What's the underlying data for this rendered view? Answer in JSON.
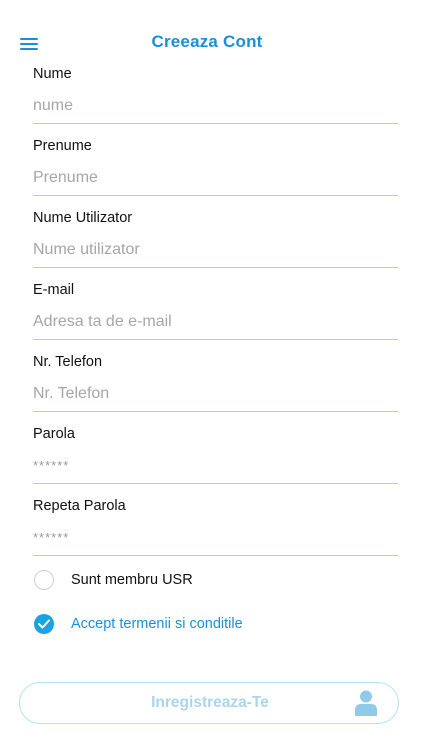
{
  "header": {
    "title": "Creeaza Cont",
    "menu_icon": "hamburger-menu-icon"
  },
  "form": {
    "fields": [
      {
        "label": "Nume",
        "placeholder": "nume",
        "value": ""
      },
      {
        "label": "Prenume",
        "placeholder": "Prenume",
        "value": ""
      },
      {
        "label": "Nume Utilizator",
        "placeholder": "Nume utilizator",
        "value": ""
      },
      {
        "label": "E-mail",
        "placeholder": "Adresa ta de e-mail",
        "value": ""
      },
      {
        "label": "Nr. Telefon",
        "placeholder": "Nr. Telefon",
        "value": ""
      },
      {
        "label": "Parola",
        "placeholder": "******",
        "value": ""
      },
      {
        "label": "Repeta Parola",
        "placeholder": "******",
        "value": ""
      }
    ]
  },
  "options": {
    "usr_member": {
      "label": "Sunt membru USR",
      "checked": false
    },
    "terms": {
      "label": "Accept termenii si conditile",
      "checked": true
    }
  },
  "register_button": {
    "label": "Inregistreaza-Te",
    "icon": "user-icon"
  },
  "colors": {
    "accent": "#1b8fd6",
    "check_fill": "#1aa3e0",
    "underline": "#9bd3ec",
    "button_text": "#a9d6ec",
    "button_border": "#b5e1f3",
    "placeholder": "#a6a6a6"
  }
}
